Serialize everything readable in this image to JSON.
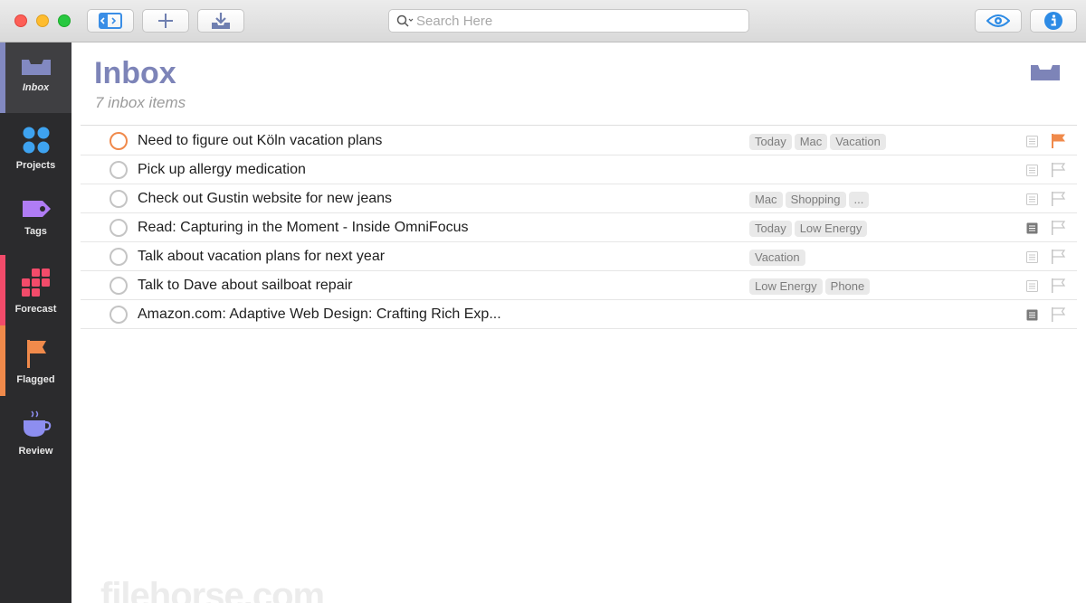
{
  "search": {
    "placeholder": "Search Here"
  },
  "sidebar": {
    "items": [
      {
        "label": "Inbox",
        "icon": "inbox-icon",
        "color": "#8289c1"
      },
      {
        "label": "Projects",
        "icon": "projects-icon",
        "color": "#3ea3f0"
      },
      {
        "label": "Tags",
        "icon": "tag-icon",
        "color": "#b07cf5"
      },
      {
        "label": "Forecast",
        "icon": "forecast-icon",
        "color": "#f24b6a"
      },
      {
        "label": "Flagged",
        "icon": "flag-icon",
        "color": "#f08a4b"
      },
      {
        "label": "Review",
        "icon": "review-icon",
        "color": "#8d8ef0"
      }
    ]
  },
  "header": {
    "title": "Inbox",
    "subtitle": "7 inbox items"
  },
  "items": [
    {
      "title": "Need to figure out Köln vacation plans",
      "tags": [
        "Today",
        "Mac",
        "Vacation"
      ],
      "note": false,
      "flagged": true
    },
    {
      "title": "Pick up allergy medication",
      "tags": [],
      "note": false,
      "flagged": false
    },
    {
      "title": "Check out Gustin website for new jeans",
      "tags": [
        "Mac",
        "Shopping",
        "..."
      ],
      "note": false,
      "flagged": false
    },
    {
      "title": "Read: Capturing in the Moment - Inside OmniFocus",
      "tags": [
        "Today",
        "Low Energy"
      ],
      "note": true,
      "flagged": false
    },
    {
      "title": "Talk about vacation plans for next year",
      "tags": [
        "Vacation"
      ],
      "note": false,
      "flagged": false
    },
    {
      "title": "Talk to Dave about sailboat repair",
      "tags": [
        "Low Energy",
        "Phone"
      ],
      "note": false,
      "flagged": false
    },
    {
      "title": "Amazon.com: Adaptive Web Design: Crafting Rich Exp...",
      "tags": [],
      "note": true,
      "flagged": false
    }
  ],
  "watermark": "filehorse.com"
}
